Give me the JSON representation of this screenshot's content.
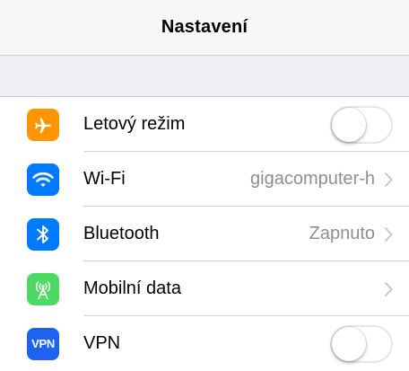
{
  "nav": {
    "title": "Nastavení"
  },
  "colors": {
    "airplane": "#ff9500",
    "wifi": "#007aff",
    "bluetooth": "#007aff",
    "cellular": "#4cd964",
    "vpn": "#1d62f0"
  },
  "rows": [
    {
      "label": "Letový režim",
      "icon": "airplane-icon",
      "control": "toggle",
      "toggle_on": false
    },
    {
      "label": "Wi-Fi",
      "icon": "wifi-icon",
      "value": "gigacomputer-h",
      "control": "chevron"
    },
    {
      "label": "Bluetooth",
      "icon": "bluetooth-icon",
      "value": "Zapnuto",
      "control": "chevron"
    },
    {
      "label": "Mobilní data",
      "icon": "antenna-icon",
      "control": "chevron"
    },
    {
      "label": "VPN",
      "icon": "vpn-icon",
      "icon_text": "VPN",
      "control": "toggle",
      "toggle_on": false
    }
  ]
}
